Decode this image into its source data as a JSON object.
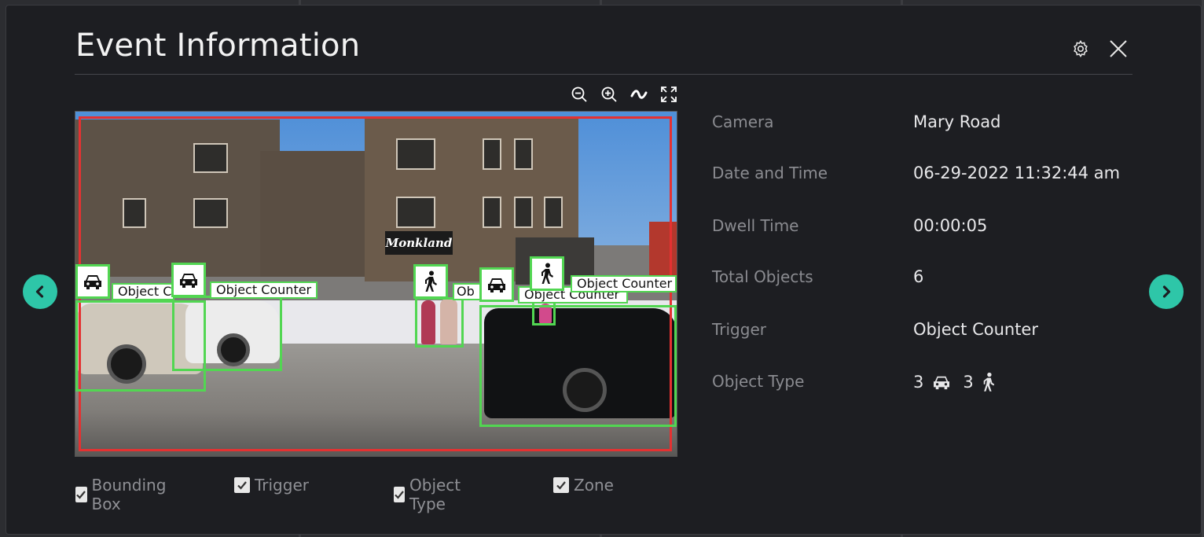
{
  "dialog": {
    "title": "Event Information"
  },
  "video": {
    "object_labels": [
      "Object C",
      "Object Counter",
      "Ob",
      "Object Counter",
      "Object Counter"
    ],
    "sign_text": "Monkland"
  },
  "info": {
    "rows": [
      {
        "label": "Camera",
        "value": "Mary Road"
      },
      {
        "label": "Date and Time",
        "value": "06-29-2022 11:32:44 am"
      },
      {
        "label": "Dwell Time",
        "value": "00:00:05"
      },
      {
        "label": "Total Objects",
        "value": "6"
      },
      {
        "label": "Trigger",
        "value": "Object Counter"
      },
      {
        "label": "Object Type",
        "value": ""
      }
    ],
    "object_types": [
      {
        "count": "3",
        "icon": "car-icon"
      },
      {
        "count": "3",
        "icon": "pedestrian-icon"
      }
    ]
  },
  "overlays": [
    {
      "label": "Bounding Box",
      "checked": true
    },
    {
      "label": "Trigger",
      "checked": true
    },
    {
      "label": "Object Type",
      "checked": true
    },
    {
      "label": "Zone",
      "checked": true
    }
  ],
  "colors": {
    "accent": "#2ec6a8",
    "zone": "#e53131",
    "bbox": "#52d652"
  }
}
